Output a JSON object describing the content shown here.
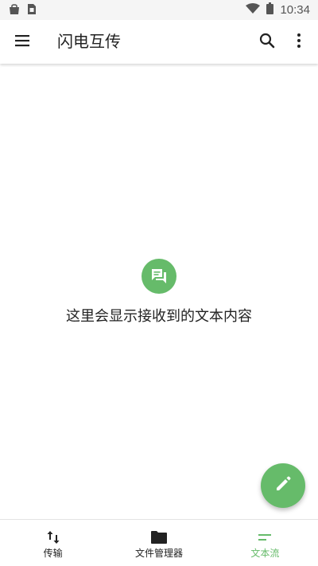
{
  "status_bar": {
    "time": "10:34",
    "left_icons": [
      "bag-icon",
      "sim-card-icon"
    ],
    "right_icons": [
      "wifi-icon",
      "battery-icon"
    ]
  },
  "app_bar": {
    "title": "闪电互传",
    "menu_icon": "menu-icon",
    "search_icon": "search-icon",
    "more_icon": "more-vert-icon"
  },
  "empty_state": {
    "icon": "chat-bubbles-icon",
    "message": "这里会显示接收到的文本内容"
  },
  "fab": {
    "icon": "pencil-icon"
  },
  "bottom_nav": {
    "items": [
      {
        "label": "传输",
        "icon": "transfer-arrows-icon",
        "active": false
      },
      {
        "label": "文件管理器",
        "icon": "folder-icon",
        "active": false
      },
      {
        "label": "文本流",
        "icon": "text-lines-icon",
        "active": true
      }
    ]
  },
  "colors": {
    "accent": "#66bb6a",
    "status_bar_bg": "#f5f5f5",
    "text_primary": "#222222"
  }
}
